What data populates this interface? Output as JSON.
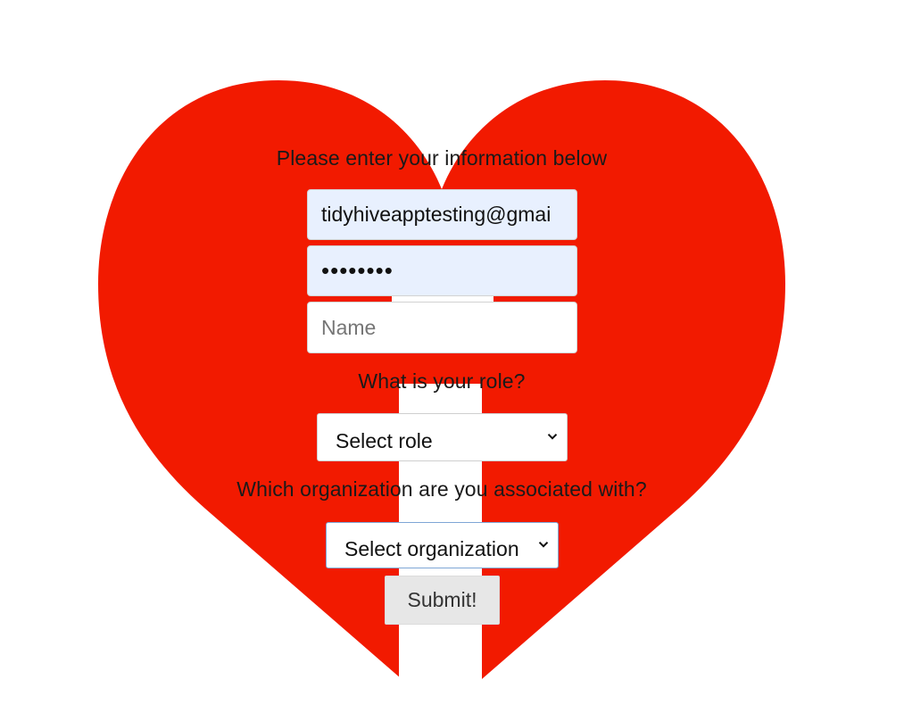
{
  "colors": {
    "heart": "#f21a00",
    "background": "#ffffff",
    "autofill": "#e8f0fe"
  },
  "form": {
    "heading": "Please enter your information below",
    "email_value": "tidyhiveapptesting@gmai",
    "password_value": "••••••••",
    "name_placeholder": "Name",
    "role_question": "What is your role?",
    "role_selected": "Select role",
    "org_question": "Which organization are you associated with?",
    "org_selected": "Select organization",
    "submit_label": "Submit!"
  },
  "icons": {
    "role_dropdown": "chevron-down-icon",
    "org_dropdown": "chevron-down-icon"
  }
}
